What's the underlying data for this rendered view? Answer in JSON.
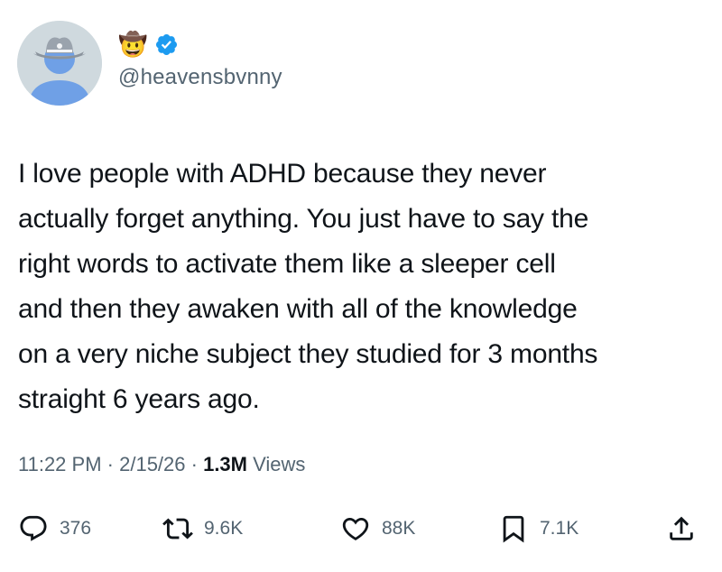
{
  "author": {
    "display_name_emoji": "🤠",
    "handle": "@heavensbvnny",
    "avatar_icon": "cowboy-avatar",
    "verified_icon": "verified-badge-icon",
    "verified_color": "#1d9bf0"
  },
  "tweet": {
    "lines": [
      "I love people with ADHD because they never",
      "actually forget anything. You just have to say the",
      "right words to activate them like a sleeper cell",
      "and then they awaken with all of the knowledge",
      "on a very niche subject they studied for 3 months",
      "straight 6 years ago."
    ]
  },
  "meta": {
    "time": "11:22 PM",
    "separator": " · ",
    "date": "2/15/26",
    "views_count": "1.3M",
    "views_label": " Views"
  },
  "actions": {
    "reply": {
      "icon": "reply-icon",
      "count": "376"
    },
    "retweet": {
      "icon": "retweet-icon",
      "count": "9.6K"
    },
    "like": {
      "icon": "heart-icon",
      "count": "88K"
    },
    "bookmark": {
      "icon": "bookmark-icon",
      "count": "7.1K"
    },
    "share": {
      "icon": "share-icon"
    }
  },
  "colors": {
    "text": "#0f1419",
    "secondary": "#536471",
    "avatar_bg": "#cfd9de",
    "avatar_figure": "#6fa0e6"
  }
}
